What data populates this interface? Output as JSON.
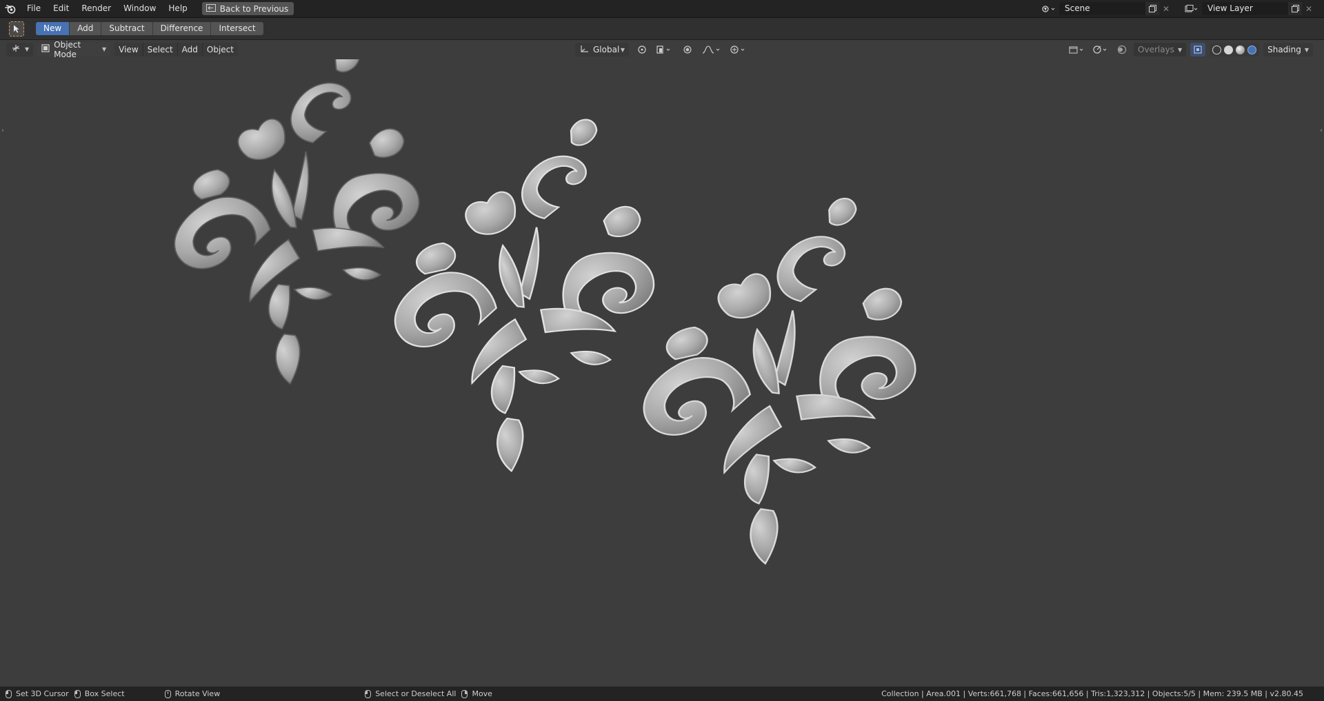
{
  "menu": {
    "items": [
      "File",
      "Edit",
      "Render",
      "Window",
      "Help"
    ],
    "back_button": "Back to Previous"
  },
  "scene": {
    "name": "Scene"
  },
  "view_layer": {
    "name": "View Layer"
  },
  "tool_settings": {
    "boolean_modes": [
      "New",
      "Add",
      "Subtract",
      "Difference",
      "Intersect"
    ],
    "active_mode": "New"
  },
  "viewport_header": {
    "mode": "Object Mode",
    "menus": [
      "View",
      "Select",
      "Add",
      "Object"
    ],
    "orientation": "Global",
    "overlays_label": "Overlays",
    "shading_label": "Shading"
  },
  "status_bar": {
    "hints": [
      {
        "button": "left",
        "label": "Set 3D Cursor"
      },
      {
        "button": "left",
        "label": "Box Select"
      },
      {
        "button": "middle",
        "label": "Rotate View"
      },
      {
        "button": "left",
        "label": "Select or Deselect All"
      },
      {
        "button": "right",
        "label": "Move"
      }
    ],
    "stats": "Collection | Area.001 | Verts:661,768 | Faces:661,656 | Tris:1,323,312 | Objects:5/5 | Mem: 239.5 MB | v2.80.45"
  },
  "viewport": {
    "objects": [
      "ornament-left",
      "ornament-middle",
      "ornament-right"
    ],
    "background_color": "#3d3d3d",
    "object_color": "#b9b9b9"
  },
  "colors": {
    "accent": "#4772b3",
    "active_tool_outline": "#d79a4a"
  }
}
